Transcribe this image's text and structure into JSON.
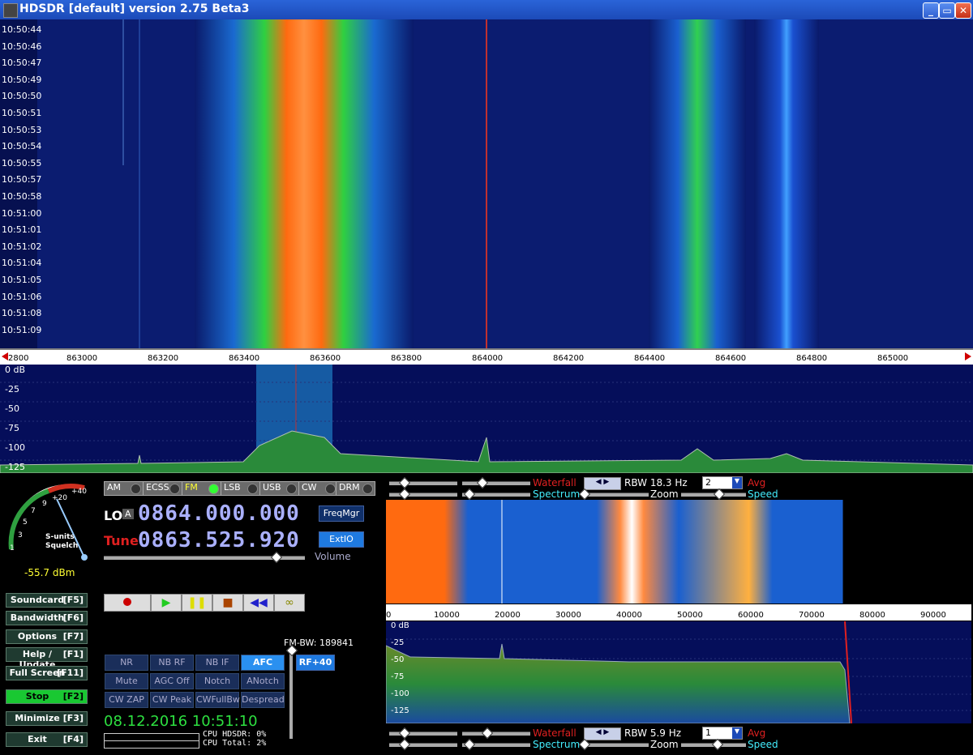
{
  "window": {
    "title": "HDSDR  [default]  version 2.75 Beta3",
    "min": "_",
    "max": "▭",
    "close": "✕"
  },
  "waterfall": {
    "times": [
      "10:50:44",
      "10:50:46",
      "10:50:47",
      "10:50:49",
      "10:50:50",
      "10:50:51",
      "10:50:53",
      "10:50:54",
      "10:50:55",
      "10:50:57",
      "10:50:58",
      "10:51:00",
      "10:51:01",
      "10:51:02",
      "10:51:04",
      "10:51:05",
      "10:51:06",
      "10:51:08",
      "10:51:09"
    ],
    "freq_labels": [
      "2800",
      "863000",
      "863200",
      "863400",
      "863600",
      "863800",
      "864000",
      "864200",
      "864400",
      "864600",
      "864800",
      "865000"
    ]
  },
  "spectrum": {
    "db_labels": [
      "0 dB",
      "-25",
      "-50",
      "-75",
      "-100",
      "-125"
    ]
  },
  "smeter": {
    "scale": [
      "1",
      "3",
      "5",
      "7",
      "9",
      "+20",
      "+40"
    ],
    "s_units": "S-units",
    "squelch": "Squelch",
    "level": "-55.7 dBm"
  },
  "left_buttons": [
    {
      "label": "Soundcard",
      "key": "[F5]"
    },
    {
      "label": "Bandwidth",
      "key": "[F6]"
    },
    {
      "label": "Options",
      "key": "[F7]"
    },
    {
      "label": "Help / Update",
      "key": "[F1]"
    },
    {
      "label": "Full Screen",
      "key": "[F11]"
    },
    {
      "label": "Stop",
      "key": "[F2]"
    },
    {
      "label": "Minimize",
      "key": "[F3]"
    },
    {
      "label": "Exit",
      "key": "[F4]"
    }
  ],
  "modes": [
    "AM",
    "ECSS",
    "FM",
    "LSB",
    "USB",
    "CW",
    "DRM"
  ],
  "lo": {
    "label": "LO",
    "badge": "A",
    "value": "0864.000.000"
  },
  "tune": {
    "label": "Tune",
    "value": "0863.525.920"
  },
  "freqmgr": "FreqMgr",
  "extio": "ExtIO",
  "volume": "Volume",
  "fm_bw": "FM-BW: 189841",
  "rf": "RF+40",
  "dsp_buttons": [
    "NR",
    "NB RF",
    "NB IF",
    "AFC",
    "Mute",
    "AGC Off",
    "Notch",
    "ANotch",
    "CW ZAP",
    "CW Peak",
    "CWFullBw",
    "Despread"
  ],
  "datetime": "08.12.2016 10:51:10",
  "cpu": {
    "hdsdr": "CPU HDSDR:  0%",
    "total": "CPU Total:  2%"
  },
  "upper_controls": {
    "waterfall": "Waterfall",
    "spectrum": "Spectrum",
    "rbw": "RBW 18.3 Hz",
    "zoom": "Zoom",
    "avg_value": "2",
    "avg": "Avg",
    "speed": "Speed"
  },
  "lower_controls": {
    "waterfall": "Waterfall",
    "spectrum": "Spectrum",
    "rbw": "RBW  5.9 Hz",
    "zoom": "Zoom",
    "avg_value": "1",
    "avg": "Avg",
    "speed": "Speed"
  },
  "small_axis": [
    "0",
    "10000",
    "20000",
    "30000",
    "40000",
    "50000",
    "60000",
    "70000",
    "80000",
    "90000"
  ],
  "small_db": [
    "0 dB",
    "-25",
    "-50",
    "-75",
    "-100",
    "-125"
  ]
}
